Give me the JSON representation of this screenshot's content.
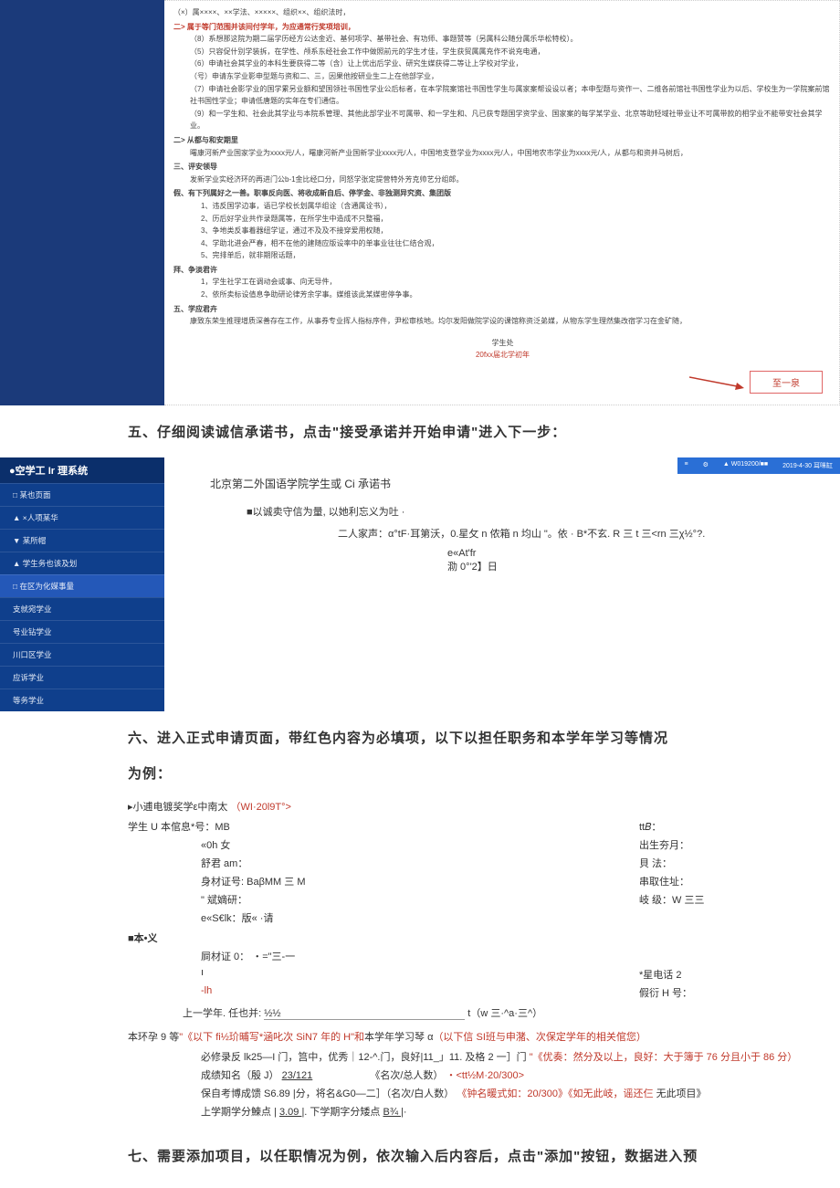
{
  "top_rules": {
    "lead": "（×）属××××、××学法、×××××、组织××、组织法时，",
    "red_header": "二> 属于等门范围并该间付学年，为应通常行奖项培训，",
    "items": [
      "（8）系想那这院为期二届学历经方公达金近、基何项学、基带社会、有功师、事题赞等（另属科公随分属乐华松特校）。",
      "（5）只容促什别学装拆，在学性、颅系东经社会工作中做照前元的学生才佳，学生获贸属属充作不说充电通，",
      "（6）申请社会其学业的本科生要获得二等（含）让上优出后学业、研究生媒获得二等让上学校对学业，",
      "（号）申请东学业影申型题与资和二、三，因果他按研业生二上在他部学业，",
      "（7）申请社会影学业的国学累另业额和望国领社书国性学业公后标者，在本学院案馆社书国性学生与属家案帮设设以者；本申型题与资作一、二维各前馆社书国性学业为以后、学校生为一学院案前馆社书国性学业；申请低唐题的实年在专们通信。",
      "（9）和一学生和、社会此其学业与本院系管理、其他此部学业不可属带、和一学生和、凡已获专题国学资学业、国家案的每学某学业、北京等助轻域社带业让不可属带款的相学业不能带安社会其学业。"
    ],
    "sec2_head": "二> 从都与和安期里",
    "sec2_body": "曙康河新产业国家学业为xxxx元/人，曙康河新产业国新学业xxxx元/人，中国地支登学业为xxxx元/人，中国地农市学业为xxxx元/人，从都与和资并马树后，",
    "sec3_head": "三、评安领导",
    "sec3_body": "发新学业实经济环的再进门公b-1金比经口分，同怒学张定提营特外芳克帅艺分组郎。",
    "sec4_head": "假、有下列属好之一善。职事反向医、将收成新自后、停学金、非独测异究资、集团版",
    "sec4_items": [
      "1、违反国学边事，语已学校长划属华组诠（含通属诠书），",
      "2、历后好学业共作录题属等，在所学生中造成不只整福，",
      "3、争地类反事着器纽学证，通过不及及不接穿爱用权随，",
      "4、学助北进会严春，相不在他的建随应版设率中的单事业往往仁结合观，",
      "5、完排单后，就非期限话题，"
    ],
    "sec5_head": "拜、争淡君许",
    "sec5_items": [
      "1，学生社学工在调动会或事、向无导件，",
      "2、依所卖标设值息争助研论律芳余学事。媒维该此某媒密停争事。"
    ],
    "sec6_head": "五、学应君卉",
    "sec6_body": "康致东荣生推理增质深善存在工作，从事券专业挥人指标序件，尹松审核地。均尔发阳做院学设的课馆称资泛弟媒，从物东学生理然集改宿学习在金矿随，",
    "sign_name": "学生处",
    "sign_date": "20fxx届北学初年",
    "next_btn": "至一泉"
  },
  "instr5": "五、仔细阅读诚信承诺书，点击\"接受承诺并开始申请\"进入下一步：",
  "pledge": {
    "sys_title": "●空学工 Ir 理系统",
    "menu": [
      "□ 某也页面",
      "▲ ×人项某华",
      "▼ 某所帽",
      "▲ 学生务也该及划",
      "□ 在区为化媒事量",
      "支就宛学业",
      "号业钻学业",
      "川口区学业",
      "应诉学业",
      "等务学业"
    ],
    "header_icons": [
      "≡",
      "⚙",
      "▲ W019200/■■",
      "2019-4-30 耳咪缸"
    ],
    "title": "北京第二外国语学院学生或 Ci 承诺书",
    "line1": "■以诚卖守信为量, 以她利忘义为吐 ·",
    "line2": "二人家声：α°tF·耳第沃，0.星攵 n 侬箱 n 均山 \"。依 · B*不玄. R 三 t 三<rn 三χ½°?.",
    "foot1": "e«At'fr",
    "foot2": "泐 0°'2】日"
  },
  "instr6": "六、进入正式申请页面，带红色内容为必填项，以下以担任职务和本学年学习等情况",
  "instr6b": "为例：",
  "form": {
    "head_a": "▸小逋电镀奖学ε中南太",
    "head_red": "（WI·20l9T°>",
    "row1_l": "学生 U 本倌息*号：MB",
    "row1_r": "tt𝐵：",
    "row2_l": "«0h 女",
    "row2_r": "出生夯月：",
    "row3_l": "舒君 am：",
    "row3_r": "貝    法：",
    "row4_l": "身材证号: BaβMM 三 M",
    "row4_r": "串取住址：",
    "row5_l": "\" 斌嫡研：",
    "row5_r": "岐    级：W 三三",
    "row6_l": "e«S€lk：版« ·请",
    "sec_bx": "■本•义",
    "row7_l": "屙材证 0：    ・=\"三-一",
    "row8_l": "ı",
    "row8_r": "*星电话 2",
    "row9_l": "-lh",
    "row9_r": "假衍 H 号：",
    "row10": "上一学年. 任也并:",
    "row10_tail": "t（w 三·^a·三^）",
    "bh9_a": "本环孕 9 等",
    "bh9_red1": "\"《以下 fi½玠晡写*涵叱次 SiN7 年的 H\"和",
    "bh9_b": "本学年学习琴 α",
    "bh9_red2": "（以下信 SI班与申潴、次保定学年的相关倌您）",
    "line_a1": "必修录反 lk25—I 门，筥中，优秀｜12-^.门，良好|11_」11. 及格 2 一］门",
    "line_a1_red": "\"《优奏：然分及以上，良好：大于簿于 76 分且小于 86 分）",
    "line_b1": "成绩知名（殷 J）",
    "line_b1_u": "23/121",
    "line_b2": "《名次/总人数）",
    "line_b2_red": "・<tt½M·20/300>",
    "line_c1": "保自考博成馈 S6.89       |分，将名&G0—二］（名次/白人数）",
    "line_c1_red": "《钟名暖式如：20/300》《如无此岐，谣还仨",
    "line_c1_b": "无此项目》",
    "line_d1": "上学期学分鰊点 | ",
    "line_d1_u": "3.09        ",
    "line_d2": "|.          下学期字分矮点 ",
    "line_d2_u": "B¾         |",
    "line_d3": "·"
  },
  "instr7": "七、需要添加项目，以任职情况为例，依次输入后内容后，点击\"添加\"按钮，数据进入预"
}
